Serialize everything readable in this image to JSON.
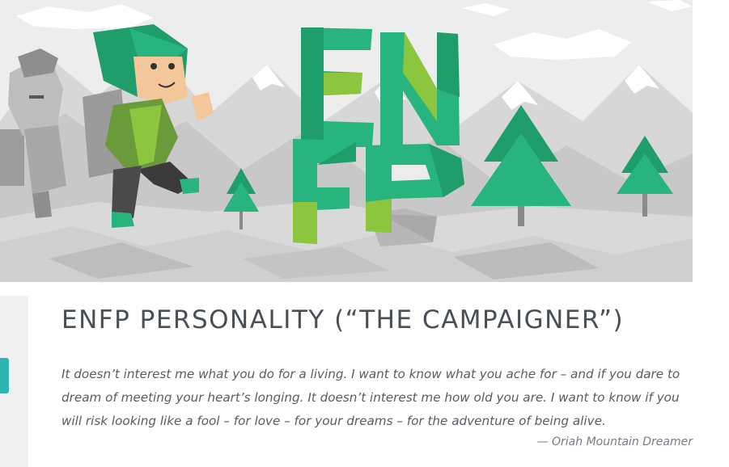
{
  "hero": {
    "letters": [
      "E",
      "N",
      "F",
      "P"
    ],
    "colors": {
      "green_dark": "#1f9e6c",
      "green_mid": "#27b47e",
      "green_light": "#8cc63f",
      "gray_bg": "#ececec"
    }
  },
  "heading": "ENFP PERSONALITY (“THE CAMPAIGNER”)",
  "quote": {
    "text": "It doesn’t interest me what you do for a living. I want to know what you ache for – and if you dare to dream of meeting your heart’s longing. It doesn’t interest me how old you are. I want to know if you will risk looking like a fool – for love – for your dreams – for the adventure of being alive.",
    "attribution": "— Oriah Mountain Dreamer"
  },
  "accent_color": "#2fb5b0"
}
